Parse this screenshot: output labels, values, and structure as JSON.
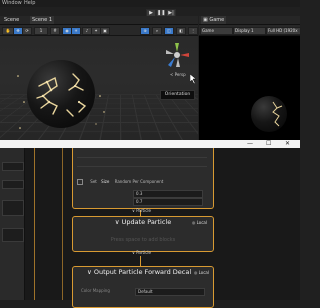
{
  "menu": {
    "items": [
      "Window",
      "Help"
    ]
  },
  "playbar": {
    "buttons": [
      "▶",
      "❚❚",
      "▶|"
    ]
  },
  "scene_window": {
    "tab_label": "Scene",
    "tab_label_2": "Scene 1",
    "toolbar": {
      "pivot_value": "1",
      "persp_label": "< Persp"
    },
    "orientation_tooltip": "Orientation"
  },
  "game_window": {
    "tab_label": "Game",
    "display_select": "Game",
    "display_value": "Display 1",
    "resolution_value": "Full HD (1920x"
  },
  "vfx_window": {
    "window_buttons": [
      "—",
      "☐",
      "✕"
    ],
    "set_size": {
      "set_label": "Set",
      "attr_label": "Size",
      "mode_label": "Random Per Component",
      "a_value": "0.3",
      "b_value": "0.7"
    },
    "particle_port_1": "Particle",
    "update_block": {
      "title": "Update Particle",
      "local_label": "Local",
      "faded_text": "Press space to add blocks"
    },
    "particle_port_2": "Particle",
    "output_block": {
      "title": "Output Particle  Forward Decal",
      "local_label": "Local",
      "color_mapping_label": "Color Mapping",
      "color_mapping_value": "Default"
    }
  },
  "colors": {
    "accent": "#d89a32",
    "blue_button": "#3a79c9",
    "titlebar_light": "#f3f3f3"
  }
}
